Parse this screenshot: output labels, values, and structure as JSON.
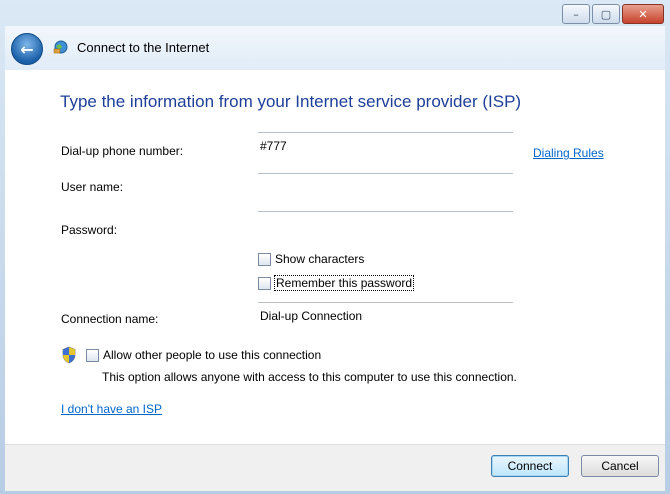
{
  "window": {
    "title": "Connect to the Internet",
    "controls": {
      "minimize": "–",
      "maximize": "▢",
      "close": "✕"
    }
  },
  "main": {
    "heading": "Type the information from your Internet service provider (ISP)",
    "phone": {
      "label": "Dial-up phone number:",
      "value": "#777"
    },
    "dialing_rules": "Dialing Rules",
    "username": {
      "label": "User name:",
      "value": ""
    },
    "password": {
      "label": "Password:",
      "value": ""
    },
    "show_characters": "Show characters",
    "remember_password": "Remember this password",
    "connection_name": {
      "label": "Connection name:",
      "value": "Dial-up Connection"
    },
    "allow_others": "Allow other people to use this connection",
    "allow_others_desc": "This option allows anyone with access to this computer to use this connection.",
    "no_isp_link": "I don't have an ISP"
  },
  "footer": {
    "connect_label": "Connect",
    "cancel_label": "Cancel"
  },
  "icons": {
    "back": "back-arrow-icon",
    "network": "network-globe-icon",
    "shield": "uac-shield-icon"
  }
}
